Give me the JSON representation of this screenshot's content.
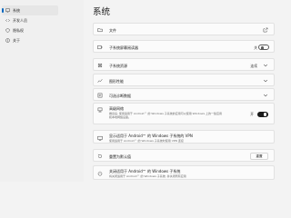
{
  "sidebar": {
    "items": [
      {
        "label": "系统",
        "icon": "system-icon",
        "selected": true
      },
      {
        "label": "开发人员",
        "icon": "developer-icon",
        "selected": false
      },
      {
        "label": "隐私权",
        "icon": "privacy-icon",
        "selected": false
      },
      {
        "label": "关于",
        "icon": "info-icon",
        "selected": false
      }
    ]
  },
  "header": {
    "title": "系统"
  },
  "rows": {
    "files": {
      "label": "文件",
      "icon": "folder-icon"
    },
    "subsystem_screen_reader": {
      "label": "子系统屏幕阅读器",
      "toggle_state": "关",
      "icon": "screen-reader-icon"
    },
    "subsystem_resources": {
      "label": "子系统资源",
      "value": "连续",
      "icon": "resources-icon"
    },
    "graphics_performance": {
      "label": "图形性能",
      "icon": "graphics-icon"
    },
    "optional_diagnostic": {
      "label": "可选诊断数据",
      "icon": "diagnostic-icon"
    },
    "advanced_networking": {
      "label": "高级网络",
      "desc_line1": "推出后, 使用适用于 Android™ 的 Windows 子系统的应用可以使用 Windows 上的一些应用",
      "desc_line2": "和本地网络设备。",
      "toggle_state": "开",
      "icon": "network-icon"
    },
    "vpn": {
      "label": "显示适用于 Android™ 的 Windows 子系统的 VPN",
      "desc": "使用适用于 Android™ 的 Windows 子系统时使用 VPN 连接",
      "icon": "vpn-icon"
    },
    "reset_defaults": {
      "label": "重置为默认值",
      "button": "重置",
      "icon": "reset-icon"
    },
    "shutdown": {
      "label": "关闭适用于 Android™ 的 Windows 子系统",
      "desc": "将关闭适用于 Android™ 的 Windows 子系统, 并关闭所有应用",
      "icon": "power-icon"
    }
  },
  "colors": {
    "accent": "#0067c0",
    "background": "#f3f3f3",
    "card": "#fbfbfb"
  }
}
